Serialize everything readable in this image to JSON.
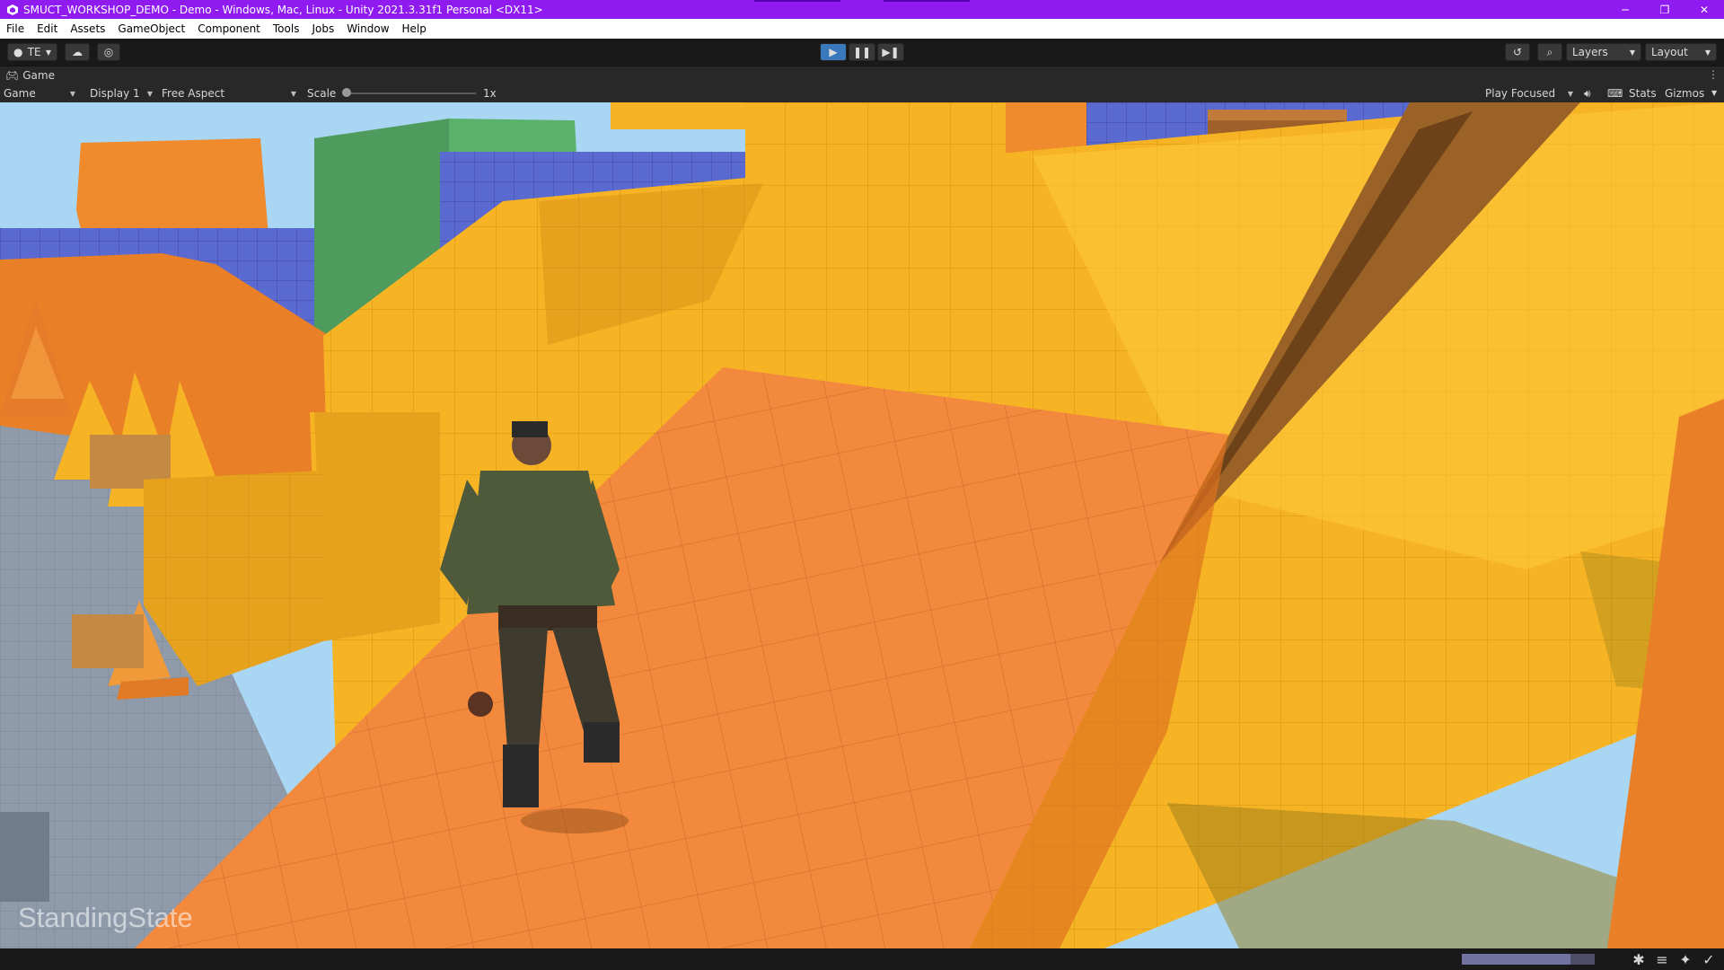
{
  "window": {
    "title": "SMUCT_WORKSHOP_DEMO - Demo - Windows, Mac, Linux - Unity 2021.3.31f1 Personal <DX11>"
  },
  "menu": [
    "File",
    "Edit",
    "Assets",
    "GameObject",
    "Component",
    "Tools",
    "Jobs",
    "Window",
    "Help"
  ],
  "toolbar": {
    "account_label": "TE",
    "layers_label": "Layers",
    "layout_label": "Layout"
  },
  "game_tab": {
    "label": "Game"
  },
  "game_view": {
    "mode": "Game",
    "display": "Display 1",
    "aspect": "Free Aspect",
    "scale_label": "Scale",
    "scale_value": "1x",
    "play_mode": "Play Focused",
    "stats_label": "Stats",
    "gizmos_label": "Gizmos"
  },
  "overlay": {
    "state_text": "StandingState"
  },
  "status": {
    "progress": 0.82
  },
  "colors": {
    "titlebar": "#8f1bf0",
    "play_active": "#3a79bb",
    "sky": "#a9d6f2",
    "yellow_block": "#f6b425",
    "orange_ramp": "#f3893c"
  }
}
